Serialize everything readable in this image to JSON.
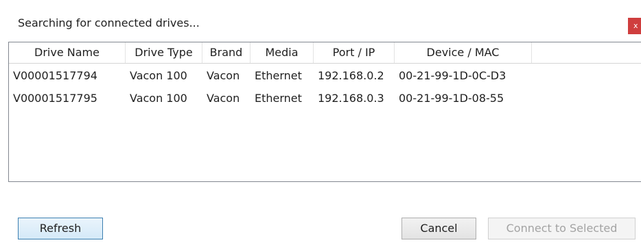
{
  "dialog": {
    "title": "Searching for connected drives...",
    "close_label": "x"
  },
  "table": {
    "columns": [
      "Drive Name",
      "Drive Type",
      "Brand",
      "Media",
      "Port / IP",
      "Device / MAC"
    ],
    "rows": [
      [
        "V00001517794",
        "Vacon 100",
        "Vacon",
        "Ethernet",
        "192.168.0.2",
        "00-21-99-1D-0C-D3"
      ],
      [
        "V00001517795",
        "Vacon 100",
        "Vacon",
        "Ethernet",
        "192.168.0.3",
        "00-21-99-1D-08-55"
      ]
    ]
  },
  "buttons": {
    "refresh_label": "Refresh",
    "cancel_label": "Cancel",
    "connect_label": "Connect to Selected"
  },
  "colors": {
    "close_button_bg": "#cf3e3e",
    "list_border": "#828790",
    "refresh_border": "#3c7fb1",
    "disabled_text": "#a3a3a3"
  }
}
